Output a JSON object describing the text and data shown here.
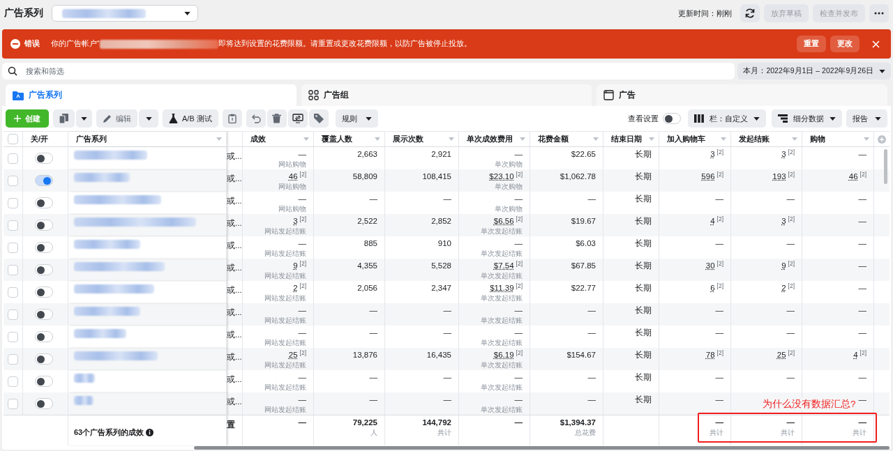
{
  "header": {
    "title": "广告系列",
    "updated": "更新时间：刚刚",
    "buttons": [
      {
        "label": "放弃草稿",
        "disabled": true
      },
      {
        "label": "检查并发布",
        "disabled": true
      }
    ]
  },
  "banner": {
    "label": "错误",
    "message_start": "你的广告帐户“",
    "message_end": "即将达到设置的花费限额。请重置或更改花费限额，以防广告被停止投放。",
    "buttons": [
      "重置",
      "更改"
    ]
  },
  "search": {
    "placeholder": "搜索和筛选"
  },
  "date_range": "本月：2022年9月1日 – 2022年9月26日",
  "tabs": [
    {
      "label": "广告系列",
      "selected": true,
      "kind": "campaign"
    },
    {
      "label": "广告组",
      "selected": false,
      "kind": "adset"
    },
    {
      "label": "广告",
      "selected": false,
      "kind": "ad"
    }
  ],
  "toolbar": {
    "create": "创建",
    "edit": "编辑",
    "ab_test": "A/B 测试",
    "rules": "规则",
    "view_settings": {
      "label": "查看设置",
      "on": false
    },
    "columns": "栏：自定义",
    "breakdown": "细分数据",
    "reports": "报告"
  },
  "table": {
    "all_selected": false,
    "frozen_columns": [
      {
        "label": "关/开",
        "sortable": false
      },
      {
        "label": "广告系列",
        "sortable": true
      }
    ],
    "columns": [
      {
        "label": "成效",
        "sortable": true
      },
      {
        "label": "覆盖人数",
        "sortable": true
      },
      {
        "label": "展示次数",
        "sortable": true
      },
      {
        "label": "单次成效费用",
        "sortable": true
      },
      {
        "label": "花费金额",
        "sortable": true
      },
      {
        "label": "结束日期",
        "sortable": true
      },
      {
        "label": "加入购物车",
        "sortable": true
      },
      {
        "label": "发起结账",
        "sortable": true
      },
      {
        "label": "购物",
        "sortable": true
      }
    ],
    "rows": [
      {
        "selected": false,
        "on": false,
        "column_3": "或...",
        "cells": [
          {
            "value": "—",
            "sub": "网站购物"
          },
          {
            "value": "2,663"
          },
          {
            "value": "2,921"
          },
          {
            "value": "—",
            "sub": "单次购物"
          },
          {
            "value": "$22.65"
          },
          {
            "value": "长期"
          },
          {
            "value": "3",
            "note": "[2]"
          },
          {
            "value": "3",
            "note": "[2]"
          },
          {
            "value": "—"
          }
        ]
      },
      {
        "selected": false,
        "on": true,
        "column_3": "或...",
        "cells": [
          {
            "value": "46",
            "note": "[2]",
            "sub": "网站购物"
          },
          {
            "value": "58,809"
          },
          {
            "value": "108,415"
          },
          {
            "value": "$23.10",
            "note": "[2]",
            "sub": "单次购物"
          },
          {
            "value": "$1,062.78"
          },
          {
            "value": "长期"
          },
          {
            "value": "596",
            "note": "[2]"
          },
          {
            "value": "193",
            "note": "[2]"
          },
          {
            "value": "46",
            "note": "[2]"
          }
        ]
      },
      {
        "selected": false,
        "on": false,
        "column_3": "或...",
        "cells": [
          {
            "value": "—",
            "sub": "网站购物"
          },
          {
            "value": "—"
          },
          {
            "value": "—"
          },
          {
            "value": "—",
            "sub": "单次购物"
          },
          {
            "value": "—"
          },
          {
            "value": "长期"
          },
          {
            "value": "—"
          },
          {
            "value": "—"
          },
          {
            "value": "—"
          }
        ]
      },
      {
        "selected": false,
        "on": false,
        "column_3": "或...",
        "cells": [
          {
            "value": "3",
            "note": "[2]",
            "sub": "网站发起结账"
          },
          {
            "value": "2,522"
          },
          {
            "value": "2,852"
          },
          {
            "value": "$6.56",
            "note": "[2]",
            "sub": "单次发起结账"
          },
          {
            "value": "$19.67"
          },
          {
            "value": "长期"
          },
          {
            "value": "4",
            "note": "[2]"
          },
          {
            "value": "3",
            "note": "[2]"
          },
          {
            "value": "—"
          }
        ]
      },
      {
        "selected": false,
        "on": false,
        "column_3": "或...",
        "cells": [
          {
            "value": "—",
            "sub": "网站发起结账"
          },
          {
            "value": "885"
          },
          {
            "value": "910"
          },
          {
            "value": "—",
            "sub": "单次发起结账"
          },
          {
            "value": "$6.03"
          },
          {
            "value": "长期"
          },
          {
            "value": "—"
          },
          {
            "value": "—"
          },
          {
            "value": "—"
          }
        ]
      },
      {
        "selected": false,
        "on": false,
        "column_3": "或...",
        "cells": [
          {
            "value": "9",
            "note": "[2]",
            "sub": "网站发起结账"
          },
          {
            "value": "4,355"
          },
          {
            "value": "5,528"
          },
          {
            "value": "$7.54",
            "note": "[2]",
            "sub": "单次发起结账"
          },
          {
            "value": "$67.85"
          },
          {
            "value": "长期"
          },
          {
            "value": "30",
            "note": "[2]"
          },
          {
            "value": "9",
            "note": "[2]"
          },
          {
            "value": "—"
          }
        ]
      },
      {
        "selected": false,
        "on": false,
        "column_3": "或...",
        "cells": [
          {
            "value": "2",
            "note": "[2]",
            "sub": "网站发起结账"
          },
          {
            "value": "2,056"
          },
          {
            "value": "2,347"
          },
          {
            "value": "$11.39",
            "note": "[2]",
            "sub": "单次发起结账"
          },
          {
            "value": "$22.77"
          },
          {
            "value": "长期"
          },
          {
            "value": "6",
            "note": "[2]"
          },
          {
            "value": "2",
            "note": "[2]"
          },
          {
            "value": "—"
          }
        ]
      },
      {
        "selected": false,
        "on": false,
        "column_3": "或...",
        "cells": [
          {
            "value": "—",
            "sub": "网站发起结账"
          },
          {
            "value": "—"
          },
          {
            "value": "—"
          },
          {
            "value": "—",
            "sub": "单次发起结账"
          },
          {
            "value": "—"
          },
          {
            "value": "长期"
          },
          {
            "value": "—"
          },
          {
            "value": "—"
          },
          {
            "value": "—"
          }
        ]
      },
      {
        "selected": false,
        "on": false,
        "column_3": "或...",
        "cells": [
          {
            "value": "—",
            "sub": "网站发起结账"
          },
          {
            "value": "—"
          },
          {
            "value": "—"
          },
          {
            "value": "—",
            "sub": "单次发起结账"
          },
          {
            "value": "—"
          },
          {
            "value": "长期"
          },
          {
            "value": "—"
          },
          {
            "value": "—"
          },
          {
            "value": "—"
          }
        ]
      },
      {
        "selected": false,
        "on": false,
        "column_3": "或...",
        "cells": [
          {
            "value": "25",
            "note": "[2]",
            "sub": "网站发起结账"
          },
          {
            "value": "13,876"
          },
          {
            "value": "16,435"
          },
          {
            "value": "$6.19",
            "note": "[2]",
            "sub": "单次发起结账"
          },
          {
            "value": "$154.67"
          },
          {
            "value": "长期"
          },
          {
            "value": "78",
            "note": "[2]"
          },
          {
            "value": "25",
            "note": "[2]"
          },
          {
            "value": "4",
            "note": "[2]"
          }
        ]
      },
      {
        "selected": false,
        "on": false,
        "column_3": "或...",
        "cells": [
          {
            "value": "—",
            "sub": "网站发起结账"
          },
          {
            "value": "—"
          },
          {
            "value": "—"
          },
          {
            "value": "—",
            "sub": "单次发起结账"
          },
          {
            "value": "—"
          },
          {
            "value": "长期"
          },
          {
            "value": "—"
          },
          {
            "value": "—"
          },
          {
            "value": "—"
          }
        ]
      },
      {
        "selected": false,
        "on": false,
        "column_3": "或...",
        "cells": [
          {
            "value": "—",
            "sub": "网站发起结账"
          },
          {
            "value": "—"
          },
          {
            "value": "—"
          },
          {
            "value": "—",
            "sub": "单次发起结账"
          },
          {
            "value": "—"
          },
          {
            "value": "长期"
          },
          {
            "value": "—"
          },
          null,
          {
            "value": "—"
          }
        ]
      }
    ],
    "summary": {
      "label": "63个广告系列的成效",
      "column_3": "置",
      "cells": [
        {
          "value": "—"
        },
        {
          "value": "79,225",
          "sub": "人"
        },
        {
          "value": "144,792",
          "sub": "共计"
        },
        {
          "value": "—"
        },
        {
          "value": "$1,394.37",
          "sub": "总花费"
        },
        null,
        {
          "value": "—",
          "sub": "共计"
        },
        {
          "value": "—",
          "sub": "共计"
        },
        {
          "value": "—",
          "sub": "共计"
        }
      ]
    }
  },
  "annotation": "为什么没有数据汇总?"
}
